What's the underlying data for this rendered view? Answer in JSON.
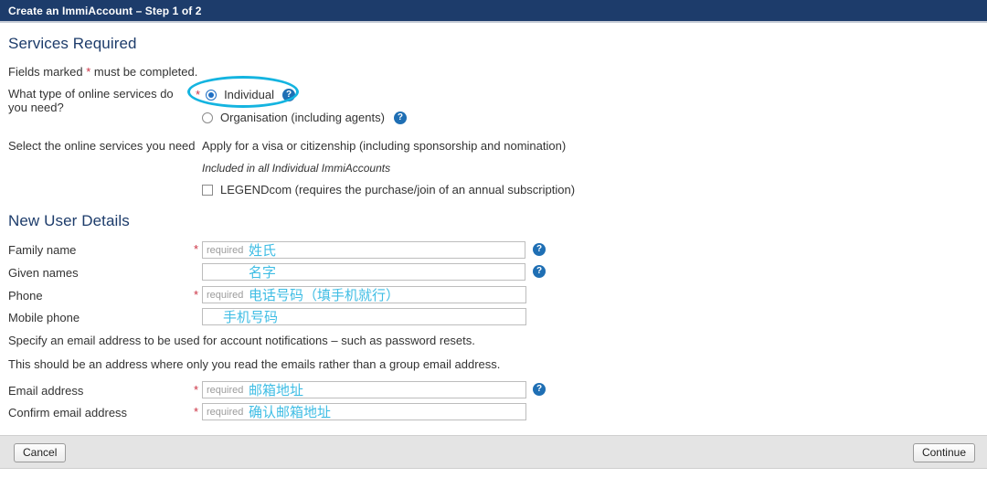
{
  "titlebar": {
    "title": "Create an ImmiAccount – Step 1 of 2"
  },
  "services_section": {
    "heading": "Services Required",
    "fields_note_prefix": "Fields marked ",
    "fields_note_star": "*",
    "fields_note_suffix": " must be completed.",
    "type_question_label": "What type of online services do you need?",
    "options": [
      {
        "label": "Individual",
        "selected": true,
        "help_icon": "help-icon",
        "required_star": "*"
      },
      {
        "label": "Organisation (including agents)",
        "selected": false,
        "help_icon": "help-icon"
      }
    ],
    "select_services_label": "Select the online services you need",
    "included_service": "Apply for a visa or citizenship (including sponsorship and nomination)",
    "included_note": "Included in all Individual ImmiAccounts",
    "legendcom_label": "LEGENDcom (requires the purchase/join of an annual subscription)"
  },
  "new_user_section": {
    "heading": "New User Details",
    "family_name_label": "Family name",
    "family_name_placeholder": "required",
    "family_name_value": "",
    "given_names_label": "Given names",
    "given_names_placeholder": "",
    "given_names_value": "",
    "phone_label": "Phone",
    "phone_placeholder": "required",
    "phone_value": "",
    "mobile_label": "Mobile phone",
    "mobile_placeholder": "",
    "mobile_value": "",
    "email_note_1": "Specify an email address to be used for account notifications – such as password resets.",
    "email_note_2": "This should be an address where only you read the emails rather than a group email address.",
    "email_label": "Email address",
    "email_placeholder": "required",
    "email_value": "",
    "confirm_email_label": "Confirm email address",
    "confirm_email_placeholder": "required",
    "confirm_email_value": "",
    "required_star": "*"
  },
  "annotations": {
    "family_name": "姓氏",
    "given_names": "名字",
    "phone": "电话号码（填手机就行）",
    "mobile": "手机号码",
    "email": "邮箱地址",
    "confirm_email": "确认邮箱地址",
    "highlight_color": "#14b4e0",
    "text_color": "#3fbde4"
  },
  "buttonbar": {
    "cancel_label": "Cancel",
    "continue_label": "Continue"
  },
  "colors": {
    "header_navy": "#1d3c6b",
    "heading_blue": "#1d3c6b",
    "accent_blue": "#1f6fb4",
    "required_red": "#cc3344",
    "annotation_cyan": "#14b4e0"
  }
}
